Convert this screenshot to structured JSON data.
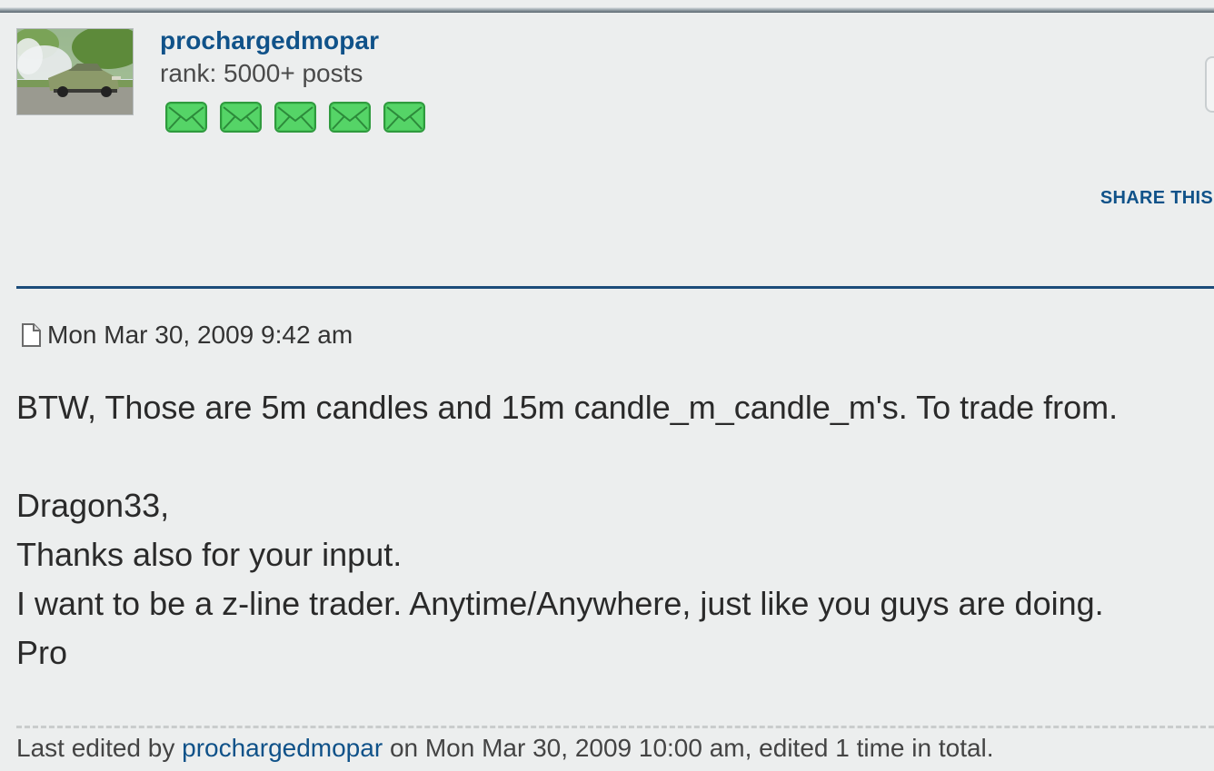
{
  "author": {
    "username": "prochargedmopar",
    "rank": "rank: 5000+ posts",
    "rank_icon": "envelope-icon",
    "rank_icon_count": 5,
    "rank_icon_color": "#3fbf4f"
  },
  "actions": {
    "share_label": "SHARE THIS"
  },
  "post": {
    "date": "Mon Mar 30, 2009 9:42 am",
    "icon": "post-file-icon",
    "lines": [
      "BTW, Those are 5m candles and 15m candle_m_candle_m's. To trade from.",
      "",
      "Dragon33,",
      "Thanks also for your input.",
      "I want to be a z-line trader. Anytime/Anywhere, just like you guys are doing.",
      "Pro"
    ]
  },
  "edit_notice": {
    "prefix": "Last edited by",
    "user": "prochargedmopar",
    "suffix": "on Mon Mar 30, 2009 10:00 am, edited 1 time in total."
  },
  "colors": {
    "link": "#105289",
    "background": "#eceeee",
    "separator": "#1c4c7a"
  }
}
